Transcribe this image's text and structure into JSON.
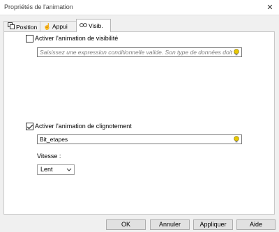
{
  "window": {
    "title": "Propriétés de l'animation",
    "close_glyph": "✕"
  },
  "tabs": [
    {
      "label": "Position",
      "icon": "position-icon"
    },
    {
      "label": "Appui",
      "icon": "hand-pointer-icon"
    },
    {
      "label": "Visib.",
      "icon": "visibility-eyes-icon"
    }
  ],
  "visibility": {
    "checkbox_label": "Activer l'animation de visibilité",
    "checked": false,
    "expression_placeholder": "Saisissez une expression conditionnelle valide. Son type de données doit ê"
  },
  "blink": {
    "checkbox_label": "Activer l'animation de clignotement",
    "checked": true,
    "expression_value": "Bit_etapes",
    "speed_label": "Vitesse :",
    "speed_value": "Lent"
  },
  "buttons": {
    "ok": "OK",
    "cancel": "Annuler",
    "apply": "Appliquer",
    "help": "Aide"
  },
  "colors": {
    "bulb": "#e8c800",
    "window_bg": "#f0f0f0"
  }
}
